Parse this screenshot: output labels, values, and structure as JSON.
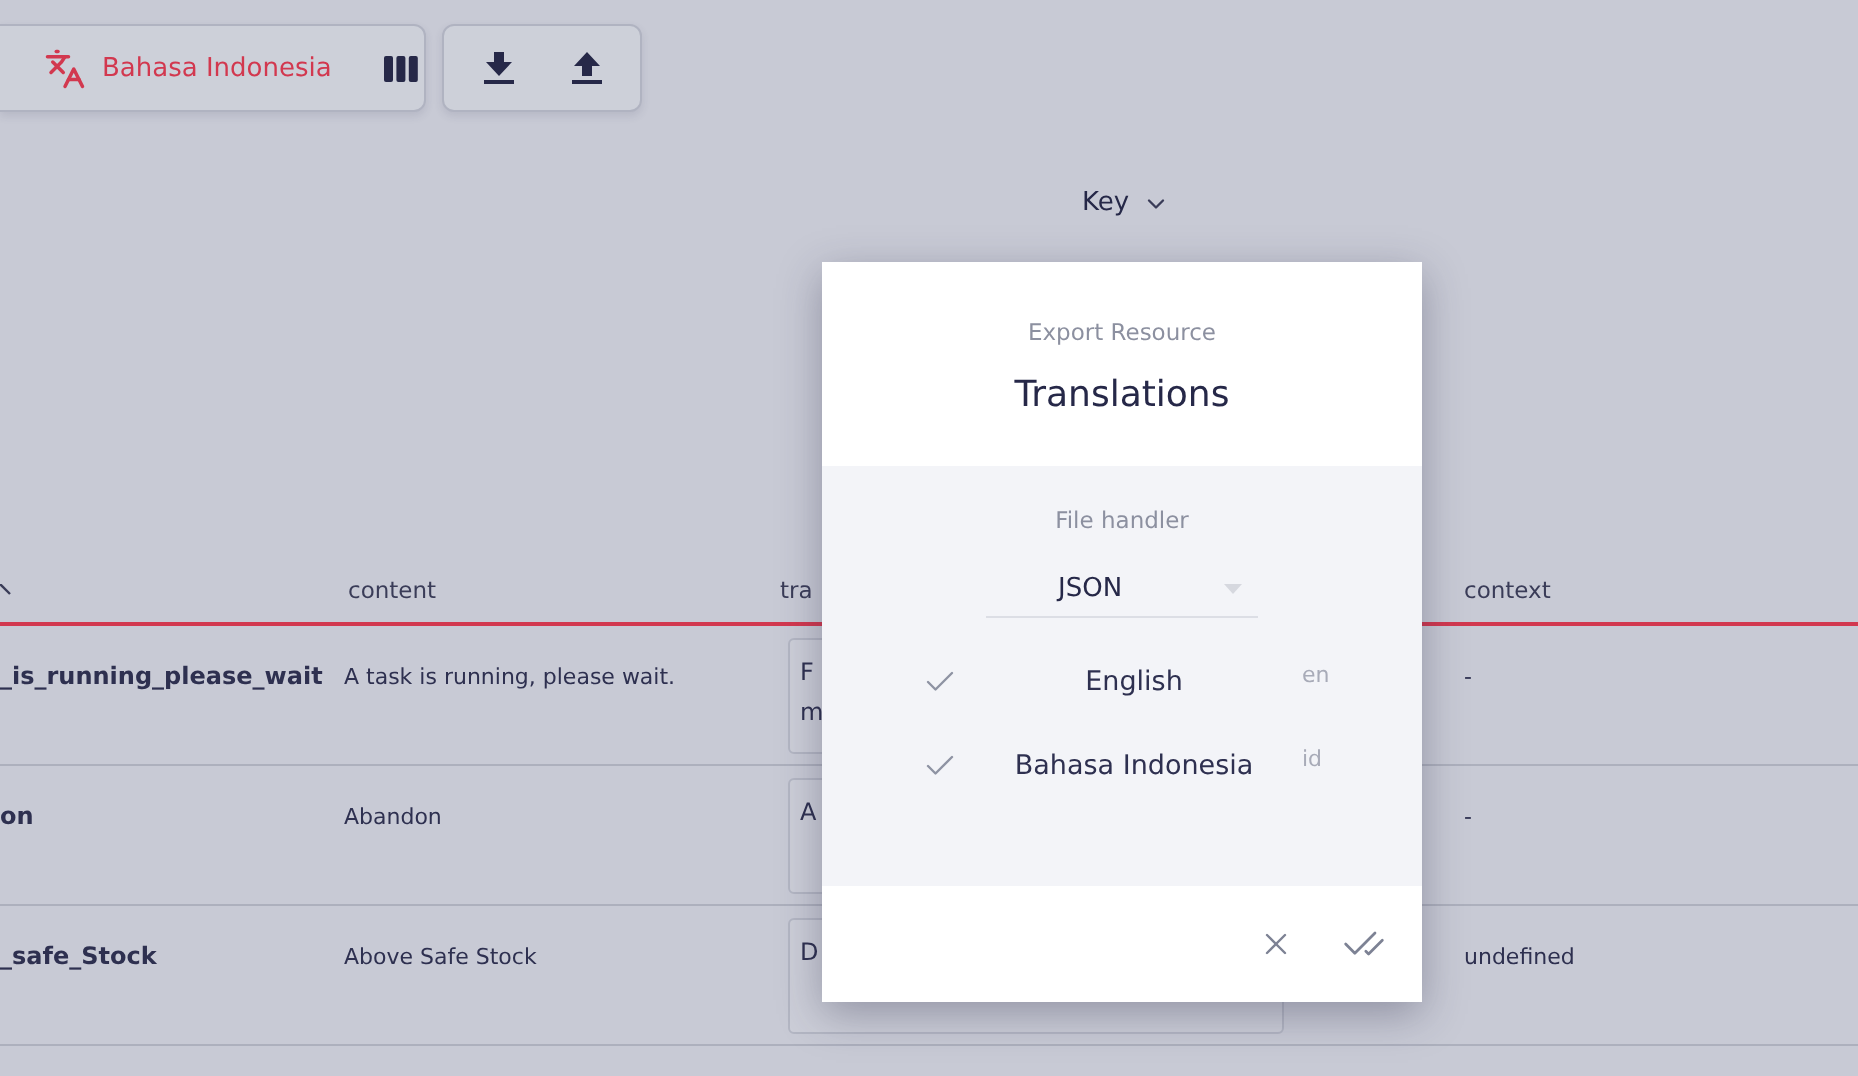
{
  "toolbar": {
    "language": "Bahasa Indonesia"
  },
  "sort": {
    "label": "Key"
  },
  "table": {
    "columns": [
      "content",
      "tra",
      "context"
    ],
    "rows": [
      {
        "key": "_is_running_please_wait",
        "content": "A task is running, please wait.",
        "translation": [
          "F",
          "m"
        ],
        "context": "-"
      },
      {
        "key": "on",
        "content": "Abandon",
        "translation": [
          "A"
        ],
        "context": "-"
      },
      {
        "key": "_safe_Stock",
        "content": "Above Safe Stock",
        "translation": [
          "D"
        ],
        "context": "undefined"
      }
    ]
  },
  "dialog": {
    "subtitle": "Export Resource",
    "title": "Translations",
    "handler_label": "File handler",
    "handler": "JSON",
    "languages": [
      {
        "name": "English",
        "code": "en",
        "checked": true
      },
      {
        "name": "Bahasa Indonesia",
        "code": "id",
        "checked": true
      }
    ]
  }
}
